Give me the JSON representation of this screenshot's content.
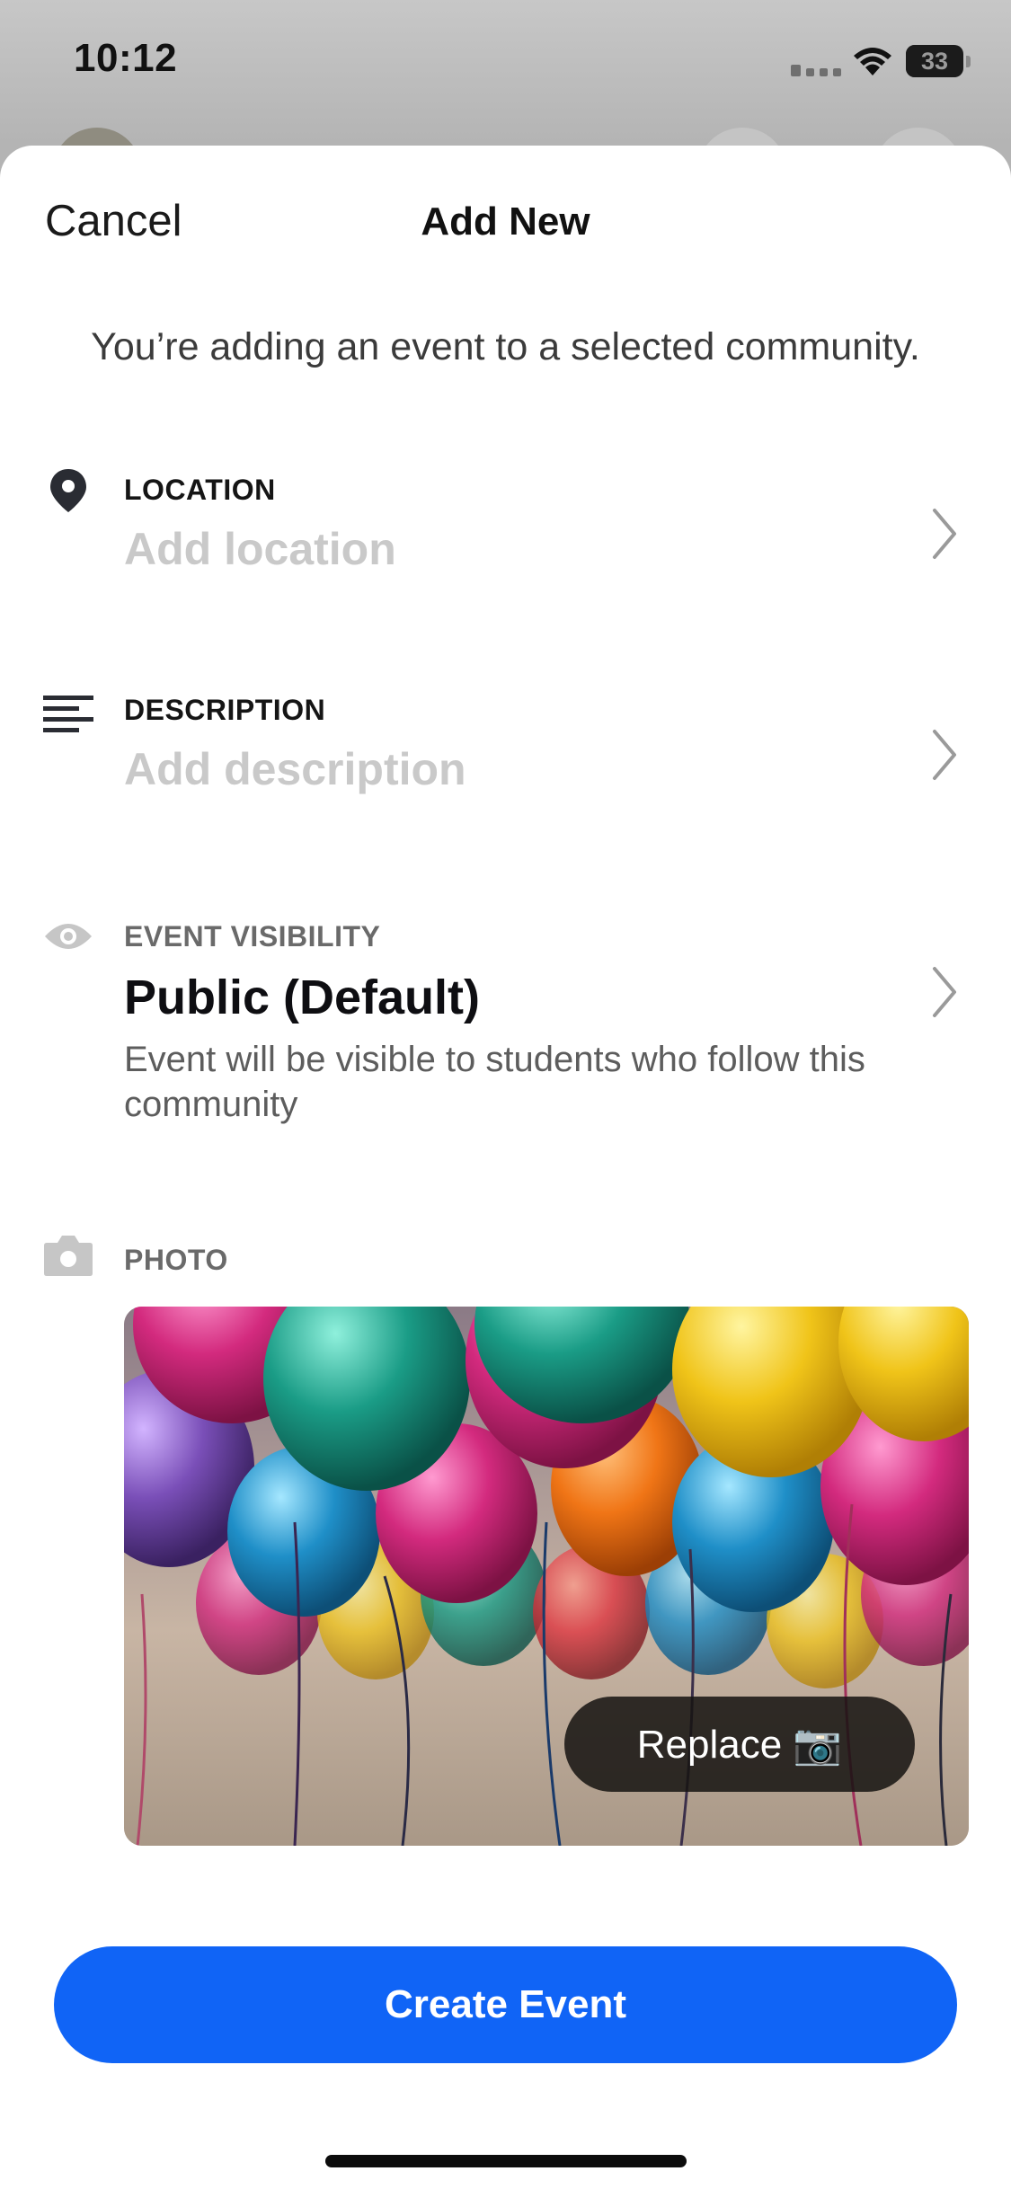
{
  "status_bar": {
    "time": "10:12",
    "battery": "33"
  },
  "header": {
    "cancel_label": "Cancel",
    "title": "Add New"
  },
  "notice": "You’re adding an event to a selected community.",
  "location": {
    "label": "LOCATION",
    "placeholder": "Add location",
    "icon": "location-pin-icon"
  },
  "description": {
    "label": "DESCRIPTION",
    "placeholder": "Add description",
    "icon": "text-lines-icon"
  },
  "visibility": {
    "label": "EVENT VISIBILITY",
    "value": "Public (Default)",
    "help": "Event will be visible to students who follow this community",
    "icon": "eye-icon"
  },
  "photo": {
    "label": "PHOTO",
    "replace_label": "Replace 📷",
    "icon": "camera-icon"
  },
  "create_button": "Create Event",
  "colors": {
    "accent": "#1064f6",
    "placeholder": "#c9c9c9"
  }
}
